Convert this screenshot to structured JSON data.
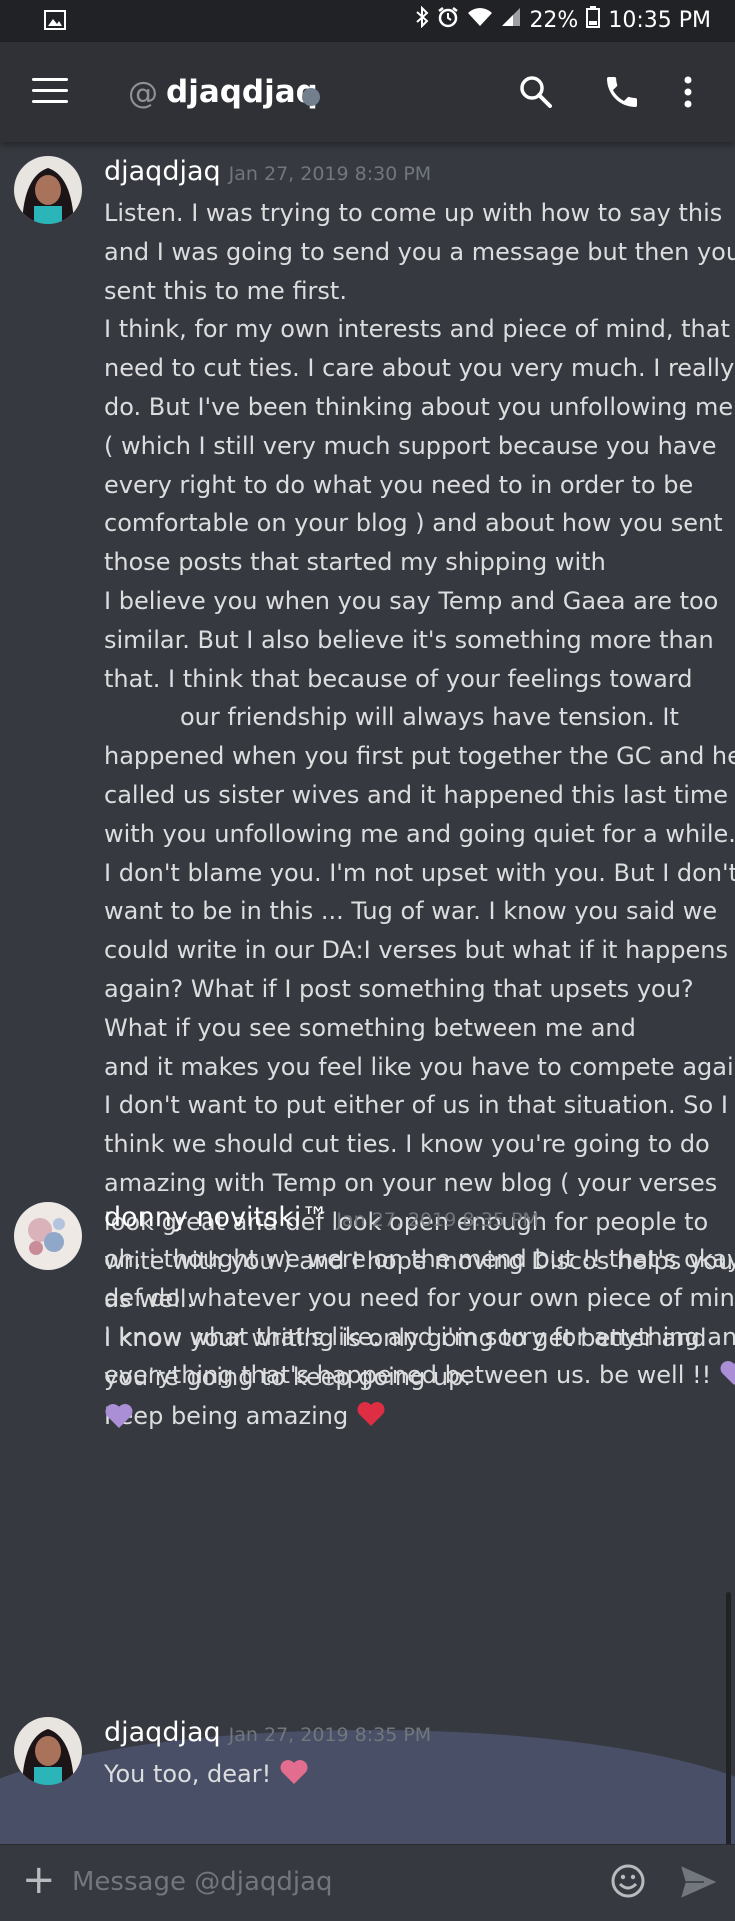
{
  "status_bar": {
    "battery": "22%",
    "time": "10:35 PM"
  },
  "header": {
    "at_symbol": "@",
    "title": "djaqdjaq"
  },
  "messages": [
    {
      "author": "djaqdjaq",
      "time": "Jan 27, 2019 8:30 PM",
      "lines": [
        "Listen. I was trying to come up with how to say this",
        "and I was going to send you a message but then you",
        "sent this to me first.",
        "I think, for my own interests and piece of mind, that I",
        "need to cut ties. I care about you very much. I really",
        "do. But I've been thinking about you unfollowing me",
        "( which I still very much support because you have",
        "every right to do what you need to in order to be",
        "comfortable on your blog ) and about how you sent",
        "those posts that started my shipping with",
        "I believe you when you say Temp and Gaea are too",
        "similar. But I also believe it's something more than",
        "that. I think that because of your feelings toward",
        "our friendship will always have tension. It",
        "happened when you first put together the GC and he",
        "called us sister wives and it happened this last time",
        "with you unfollowing me and going quiet for a while.",
        "I don't blame you. I'm not upset with you. But I don't",
        "want to be in this ... Tug of war. I know you said we",
        "could write in our DA:I verses but what if it happens",
        "again? What if I post something that upsets you?",
        "What if you see something between me and",
        "and it makes you feel like you have to compete again?",
        "I don't want to put either of us in that situation. So I",
        "think we should cut ties. I know you're going to do",
        "amazing with Temp on your new blog ( your verses",
        "look great and def look open enough for people to",
        "write with you ) and I hope moving Discos helps you",
        "as well.",
        "I know your writing is only going to get better and",
        "you're going to keep going up.",
        "Keep being amazing"
      ]
    },
    {
      "author": "donny novitski™",
      "time": "Jan 27, 2019 8:35 PM",
      "lines": [
        "oh. i thought we were on the mend but !! that's okay.",
        "def do whatever you need for your own piece of mind.",
        "i know what that's like. and i'm sorry for anything and",
        "everything that's happened between us. be well !!"
      ]
    },
    {
      "author": "djaqdjaq",
      "time": "Jan 27, 2019 8:35 PM",
      "lines": [
        "You too, dear!"
      ]
    }
  ],
  "input": {
    "placeholder": "Message @djaqdjaq"
  },
  "colors": {
    "background": "#36393f",
    "header": "#2f3136",
    "red_heart": "#dd2e44",
    "purple_heart": "#aa8ed6",
    "pink_heart": "#e36d8e"
  }
}
